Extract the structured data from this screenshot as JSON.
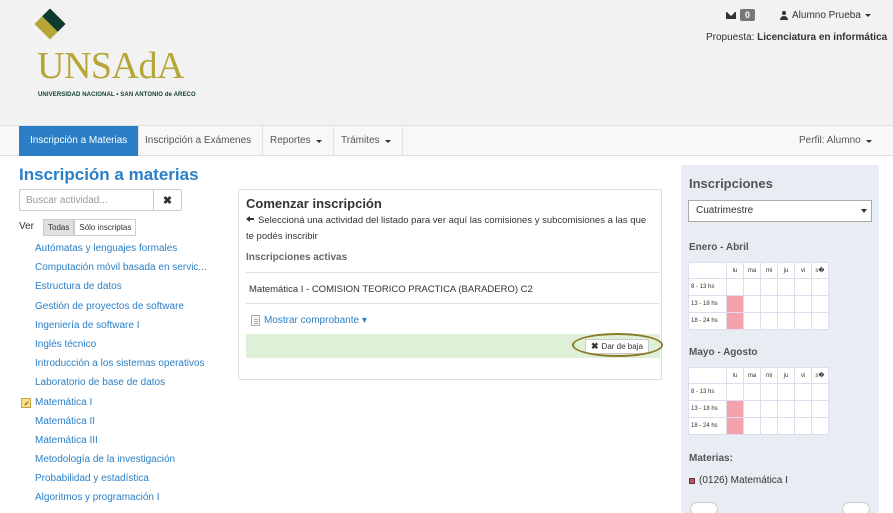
{
  "header": {
    "logo_text": "UNSAdA",
    "logo_subtitle": "UNIVERSIDAD NACIONAL • SAN ANTONIO de ARECO",
    "messages_count": "0",
    "user_name": "Alumno Prueba",
    "propuesta_label": "Propuesta:",
    "propuesta_value": "Licenciatura en informática"
  },
  "navbar": {
    "items": [
      {
        "label": "Inscripción a Materias",
        "active": true
      },
      {
        "label": "Inscripción a Exámenes"
      },
      {
        "label": "Reportes"
      },
      {
        "label": "Trámites"
      }
    ],
    "perfil": "Perfil: Alumno"
  },
  "left": {
    "title": "Inscripción a materias",
    "search_placeholder": "Buscar actividad...",
    "clear_symbol": "✖",
    "ver_label": "Ver",
    "filter_all": "Todas",
    "filter_enrolled": "Sólo inscriptas",
    "activities": [
      "Autómatas y lenguajes formales",
      "Computación móvil basada en servic...",
      "Estructura de datos",
      "Gestión de proyectos de software",
      "Ingeniería de software I",
      "Inglés técnico",
      "Introducción a los sistemas operativos",
      "Laboratorio de base de datos",
      "Matemática I",
      "Matemática II",
      "Matemática III",
      "Metodología de la investigación",
      "Probabilidad y estadística",
      "Algoritmos y programación I"
    ]
  },
  "panel": {
    "title": "Comenzar inscripción",
    "help": "Seleccioná una actividad del listado para ver aquí las comisiones y subcomisiones a las que te podés inscribir",
    "active_label": "Inscripciones activas",
    "inscription": "Matemática I - COMISION TEORICO PRACTICA (BARADERO) C2",
    "comprobante": "Mostrar comprobante ▾",
    "baja_label": "Dar de baja",
    "baja_symbol": "✖"
  },
  "sidebar": {
    "title": "Inscripciones",
    "period_select": "Cuatrimestre",
    "semesters": [
      {
        "title": "Enero - Abril",
        "days": [
          "lu",
          "ma",
          "mi",
          "ju",
          "vi",
          "s�"
        ],
        "rows": [
          {
            "label": "8 - 13 hs",
            "busy": [
              false,
              false,
              false,
              false,
              false,
              false
            ]
          },
          {
            "label": "13 - 18 hs",
            "busy": [
              true,
              false,
              false,
              false,
              false,
              false
            ]
          },
          {
            "label": "18 - 24 hs",
            "busy": [
              true,
              false,
              false,
              false,
              false,
              false
            ]
          }
        ]
      },
      {
        "title": "Mayo - Agosto",
        "days": [
          "lu",
          "ma",
          "mi",
          "ju",
          "vi",
          "s�"
        ],
        "rows": [
          {
            "label": "8 - 13 hs",
            "busy": [
              false,
              false,
              false,
              false,
              false,
              false
            ]
          },
          {
            "label": "13 - 18 hs",
            "busy": [
              true,
              false,
              false,
              false,
              false,
              false
            ]
          },
          {
            "label": "18 - 24 hs",
            "busy": [
              true,
              false,
              false,
              false,
              false,
              false
            ]
          }
        ]
      }
    ],
    "materias_title": "Materias:",
    "materia_item": "(0126) Matemática I"
  }
}
